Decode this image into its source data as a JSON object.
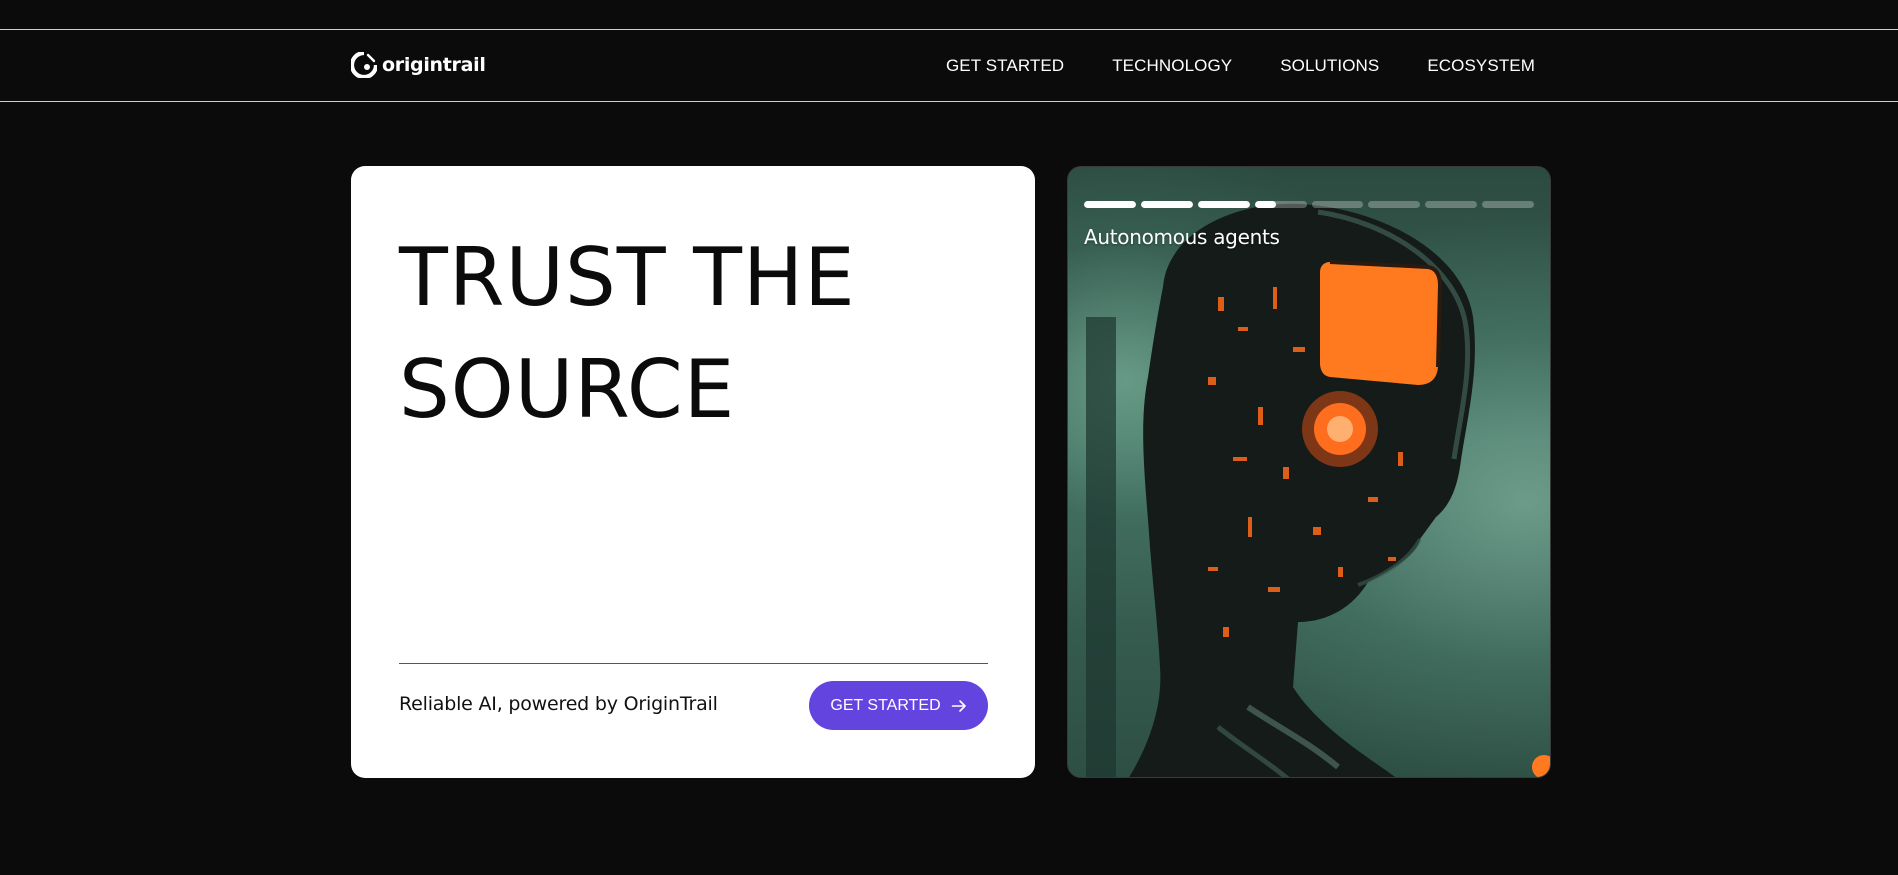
{
  "header": {
    "logo_text": "origintrail",
    "nav": [
      {
        "label": "GET STARTED"
      },
      {
        "label": "TECHNOLOGY"
      },
      {
        "label": "SOLUTIONS"
      },
      {
        "label": "ECOSYSTEM"
      }
    ]
  },
  "hero": {
    "title_line1": "TRUST THE",
    "title_line2": "SOURCE",
    "tagline": "Reliable AI, powered by OriginTrail",
    "cta_label": "GET STARTED",
    "cta_icon": "arrow-right-icon",
    "cta_color": "#6344df"
  },
  "story": {
    "label": "Autonomous agents",
    "image_subject": "robot-head-icon",
    "accent_color": "#ff7a1f",
    "progress": [
      1,
      1,
      1,
      0.42,
      0,
      0,
      0,
      0
    ]
  }
}
